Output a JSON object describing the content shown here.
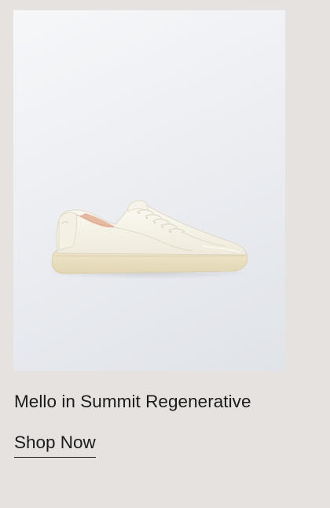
{
  "product": {
    "image_alt": "Mello sneaker in white leather on a light grey background",
    "title": "Mello in Summit Regenerative",
    "cta_label": "Shop Now"
  },
  "colors": {
    "page_background": "#e6e2df",
    "image_background": "#eceef2",
    "text": "#1b1b1b"
  }
}
